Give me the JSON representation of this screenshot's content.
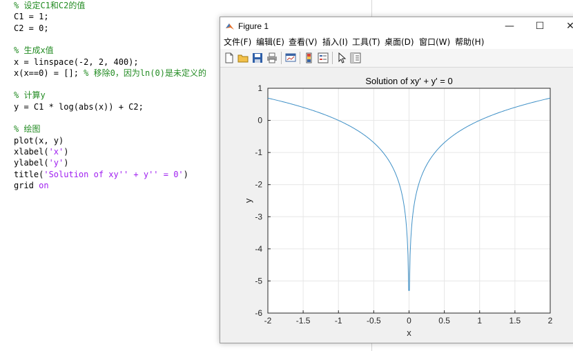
{
  "editor": {
    "lines": [
      {
        "name": "code-comment-set-constants",
        "segments": [
          {
            "t": "% 设定C1和C2的值",
            "c": "comment"
          }
        ]
      },
      {
        "name": "code-line-c1",
        "segments": [
          {
            "t": "C1 = 1;",
            "c": "code"
          }
        ]
      },
      {
        "name": "code-line-c2",
        "segments": [
          {
            "t": "C2 = 0;",
            "c": "code"
          }
        ]
      },
      {
        "name": "code-blank",
        "segments": []
      },
      {
        "name": "code-comment-generate-x",
        "segments": [
          {
            "t": "% 生成x值",
            "c": "comment"
          }
        ]
      },
      {
        "name": "code-line-linspace",
        "segments": [
          {
            "t": "x = linspace(-2, 2, 400);",
            "c": "code"
          }
        ]
      },
      {
        "name": "code-line-remove-zero",
        "segments": [
          {
            "t": "x(x==0) = []; ",
            "c": "code"
          },
          {
            "t": "% 移除0，因为ln(0)是未定义的",
            "c": "comment"
          }
        ]
      },
      {
        "name": "code-blank",
        "segments": []
      },
      {
        "name": "code-comment-compute-y",
        "segments": [
          {
            "t": "% 计算y",
            "c": "comment"
          }
        ]
      },
      {
        "name": "code-line-compute-y",
        "segments": [
          {
            "t": "y = C1 * log(abs(x)) + C2;",
            "c": "code"
          }
        ]
      },
      {
        "name": "code-blank",
        "segments": []
      },
      {
        "name": "code-comment-plot",
        "segments": [
          {
            "t": "% 绘图",
            "c": "comment"
          }
        ]
      },
      {
        "name": "code-line-plot",
        "segments": [
          {
            "t": "plot(x, y)",
            "c": "code"
          }
        ]
      },
      {
        "name": "code-line-xlabel",
        "segments": [
          {
            "t": "xlabel(",
            "c": "code"
          },
          {
            "t": "'x'",
            "c": "string"
          },
          {
            "t": ")",
            "c": "code"
          }
        ]
      },
      {
        "name": "code-line-ylabel",
        "segments": [
          {
            "t": "ylabel(",
            "c": "code"
          },
          {
            "t": "'y'",
            "c": "string"
          },
          {
            "t": ")",
            "c": "code"
          }
        ]
      },
      {
        "name": "code-line-title",
        "segments": [
          {
            "t": "title(",
            "c": "code"
          },
          {
            "t": "'Solution of xy'' + y'' = 0'",
            "c": "string"
          },
          {
            "t": ")",
            "c": "code"
          }
        ]
      },
      {
        "name": "code-line-grid",
        "segments": [
          {
            "t": "grid ",
            "c": "code"
          },
          {
            "t": "on",
            "c": "keyword"
          }
        ]
      }
    ]
  },
  "figure_window": {
    "title": "Figure 1",
    "icon": "matlab-icon",
    "controls": {
      "minimize": "—",
      "maximize": "☐",
      "close": "✕"
    },
    "menu": [
      "文件(F)",
      "编辑(E)",
      "查看(V)",
      "插入(I)",
      "工具(T)",
      "桌面(D)",
      "窗口(W)",
      "帮助(H)"
    ],
    "toolbar_icons": [
      "new-figure-icon",
      "open-file-icon",
      "save-icon",
      "print-icon",
      "link-plot-icon",
      "insert-colorbar-icon",
      "insert-legend-icon",
      "edit-plot-cursor-icon",
      "property-inspector-icon"
    ]
  },
  "chart_data": {
    "type": "line",
    "title": "Solution of xy' + y' = 0",
    "xlabel": "x",
    "ylabel": "y",
    "xlim": [
      -2,
      2
    ],
    "ylim": [
      -6,
      1
    ],
    "xticks": [
      -2,
      -1.5,
      -1,
      -0.5,
      0,
      0.5,
      1,
      1.5,
      2
    ],
    "xtick_labels": [
      "-2",
      "-1.5",
      "-1",
      "-0.5",
      "0",
      "0.5",
      "1",
      "1.5",
      "2"
    ],
    "yticks": [
      1,
      0,
      -1,
      -2,
      -3,
      -4,
      -5,
      -6
    ],
    "ytick_labels": [
      "1",
      "0",
      "-1",
      "-2",
      "-3",
      "-4",
      "-5",
      "-6"
    ],
    "grid": true,
    "series": [
      {
        "color": "#3d8fc6",
        "function": "log(abs(x))",
        "x": [
          -2,
          -1.75,
          -1.5,
          -1.25,
          -1,
          -0.75,
          -0.5,
          -0.3,
          -0.2,
          -0.1,
          -0.05,
          -0.02,
          -0.005,
          0.005,
          0.02,
          0.05,
          0.1,
          0.2,
          0.3,
          0.5,
          0.75,
          1,
          1.25,
          1.5,
          1.75,
          2
        ],
        "y": [
          0.693,
          0.56,
          0.405,
          0.223,
          0,
          -0.288,
          -0.693,
          -1.204,
          -1.609,
          -2.303,
          -2.996,
          -3.912,
          -5.298,
          -5.298,
          -3.912,
          -2.996,
          -2.303,
          -1.609,
          -1.204,
          -0.693,
          -0.288,
          0,
          0.223,
          0.405,
          0.56,
          0.693
        ]
      }
    ]
  }
}
